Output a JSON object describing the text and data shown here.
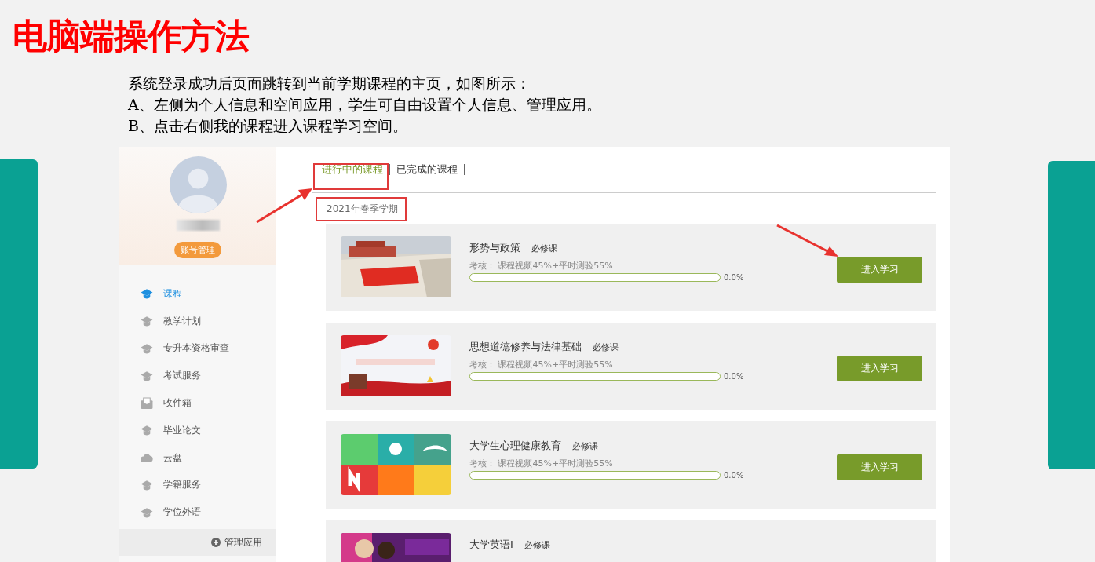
{
  "slide": {
    "title": "电脑端操作方法",
    "lines": [
      "系统登录成功后页面跳转到当前学期课程的主页，如图所示：",
      "A、左侧为个人信息和空间应用，学生可自由设置个人信息、管理应用。",
      "B、点击右侧我的课程进入课程学习空间。"
    ]
  },
  "profile": {
    "account_button": "账号管理"
  },
  "sidebar": {
    "items": [
      {
        "label": "课程",
        "kind": "cap",
        "selected": true
      },
      {
        "label": "教学计划",
        "kind": "cap",
        "selected": false
      },
      {
        "label": "专升本资格审查",
        "kind": "cap",
        "selected": false
      },
      {
        "label": "考试服务",
        "kind": "cap",
        "selected": false
      },
      {
        "label": "收件箱",
        "kind": "mail",
        "selected": false
      },
      {
        "label": "毕业论文",
        "kind": "cap",
        "selected": false
      },
      {
        "label": "云盘",
        "kind": "cloud",
        "selected": false
      },
      {
        "label": "学籍服务",
        "kind": "cap",
        "selected": false
      },
      {
        "label": "学位外语",
        "kind": "cap",
        "selected": false
      }
    ],
    "manage": "管理应用"
  },
  "tabs": [
    {
      "label": "进行中的课程",
      "selected": true
    },
    {
      "label": "已完成的课程",
      "selected": false
    }
  ],
  "term": "2021年春季学期",
  "courses": [
    {
      "title": "形势与政策",
      "tag": "必修课",
      "assessment": "考核： 课程视频45%+平时测验55%",
      "level": 0,
      "reading": "0.0%",
      "button": "进入学习"
    },
    {
      "title": "思想道德修养与法律基础",
      "tag": "必修课",
      "assessment": "考核： 课程视频45%+平时测验55%",
      "level": 0,
      "reading": "0.0%",
      "button": "进入学习"
    },
    {
      "title": "大学生心理健康教育",
      "tag": "必修课",
      "assessment": "考核： 课程视频45%+平时测验55%",
      "level": 0,
      "reading": "0.0%",
      "button": "进入学习"
    },
    {
      "title": "大学英语Ⅰ",
      "tag": "必修课"
    }
  ]
}
